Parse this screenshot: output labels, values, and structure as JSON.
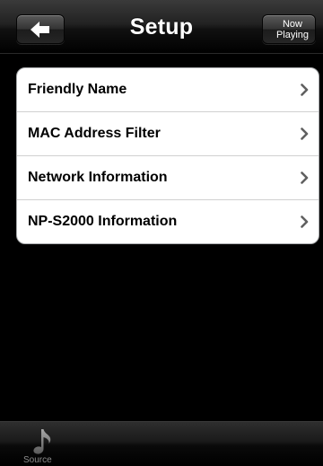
{
  "navbar": {
    "title": "Setup",
    "back_icon": "left-arrow-icon",
    "now_playing_line1": "Now",
    "now_playing_line2": "Playing"
  },
  "settings": {
    "items": [
      {
        "label": "Friendly Name"
      },
      {
        "label": "MAC Address Filter"
      },
      {
        "label": "Network Information"
      },
      {
        "label": "NP-S2000 Information"
      }
    ],
    "chevron_icon": "chevron-right-icon"
  },
  "tabbar": {
    "source_label": "Source",
    "source_icon": "music-note-icon"
  },
  "colors": {
    "background": "#000000",
    "list_background": "#ffffff",
    "chevron": "#606060",
    "tab_label": "#8c8c8c"
  }
}
